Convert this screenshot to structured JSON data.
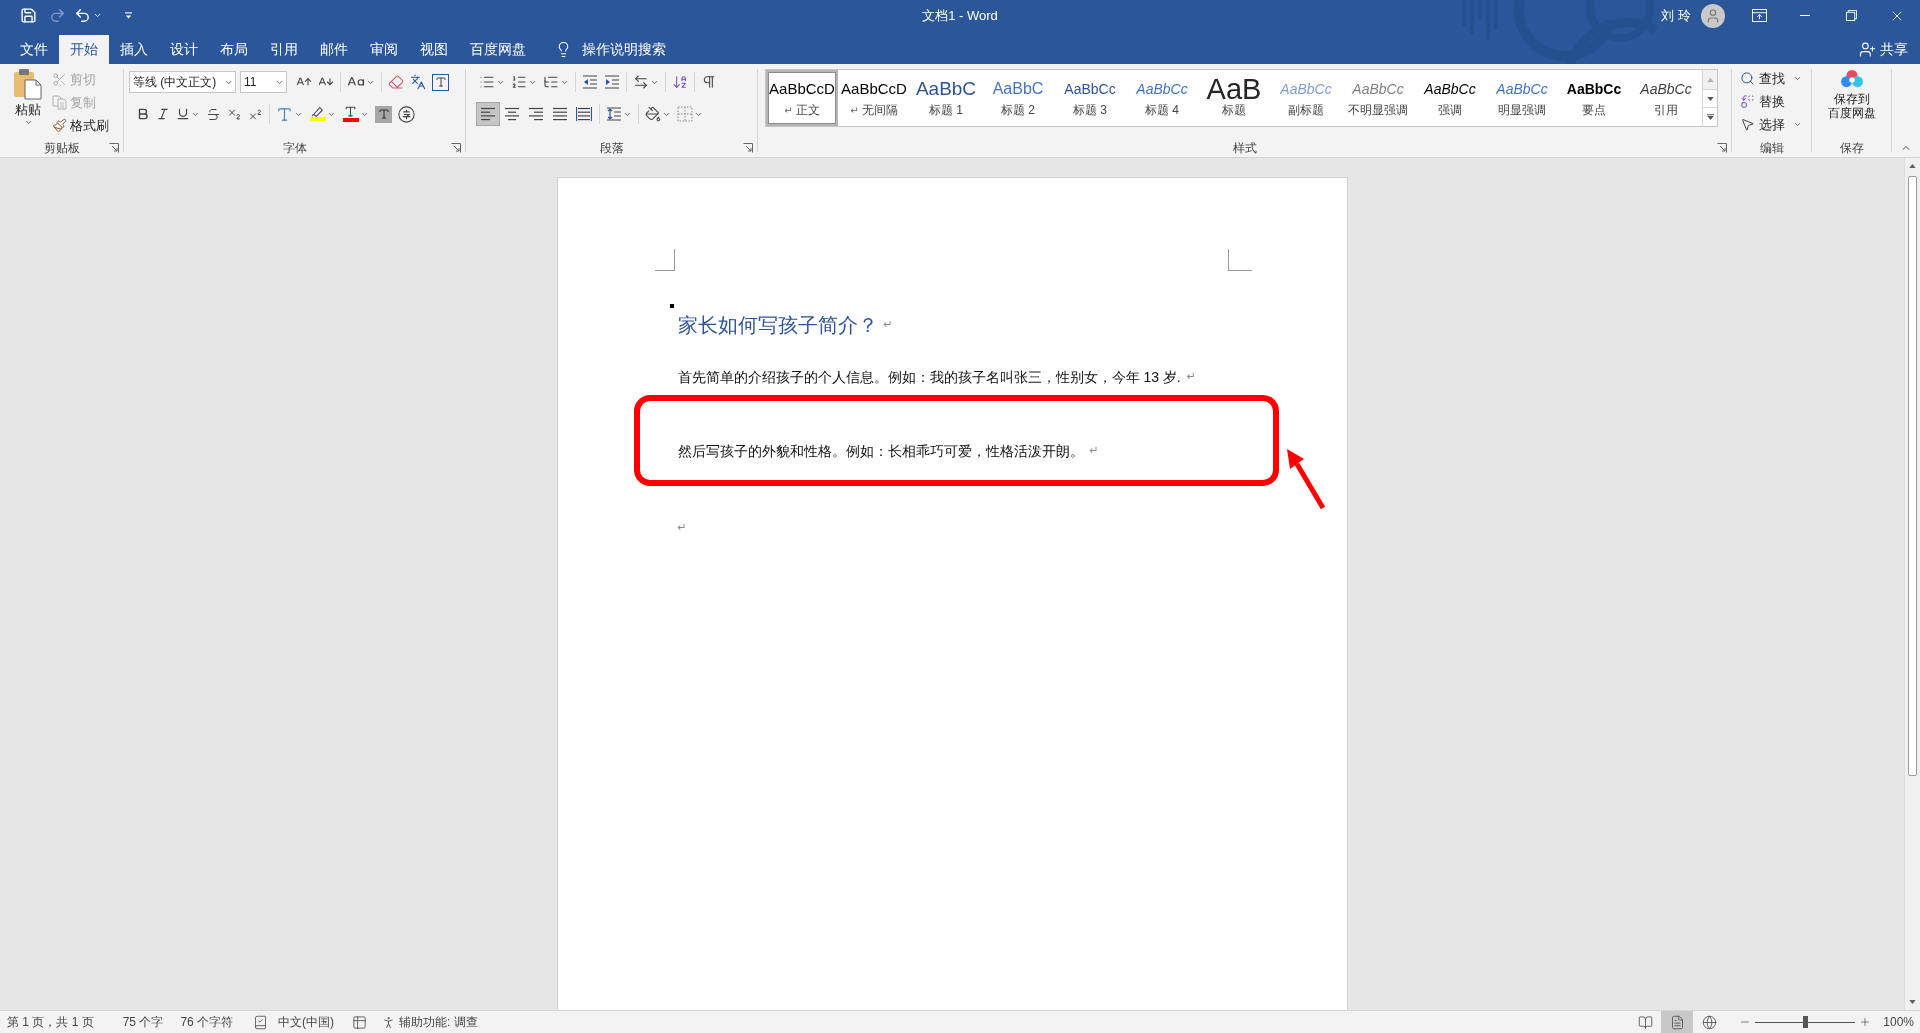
{
  "title_bar": {
    "title": "文档1 - Word",
    "user": "刘 玲"
  },
  "quick_access": [
    {
      "kind": "save",
      "disabled": false
    },
    {
      "kind": "redo",
      "disabled": true
    },
    {
      "kind": "undo",
      "disabled": false
    }
  ],
  "tabs": [
    {
      "label": "文件",
      "selected": false
    },
    {
      "label": "开始",
      "selected": true
    },
    {
      "label": "插入",
      "selected": false
    },
    {
      "label": "设计",
      "selected": false
    },
    {
      "label": "布局",
      "selected": false
    },
    {
      "label": "引用",
      "selected": false
    },
    {
      "label": "邮件",
      "selected": false
    },
    {
      "label": "审阅",
      "selected": false
    },
    {
      "label": "视图",
      "selected": false
    },
    {
      "label": "百度网盘",
      "selected": false
    }
  ],
  "tell_me": {
    "placeholder": "操作说明搜索"
  },
  "share": {
    "label": "共享"
  },
  "clipboard": {
    "title": "剪贴板",
    "paste": "粘贴",
    "items": [
      {
        "kind": "cut",
        "label": "剪切",
        "disabled": true
      },
      {
        "kind": "copy",
        "label": "复制",
        "disabled": true
      },
      {
        "kind": "painter",
        "label": "格式刷",
        "disabled": false
      }
    ]
  },
  "font": {
    "title": "字体",
    "font_name": "等线 (中文正文)",
    "font_size": "11"
  },
  "paragraph": {
    "title": "段落",
    "alignment": [
      {
        "kind": "left",
        "selected": true
      },
      {
        "kind": "center",
        "selected": false
      },
      {
        "kind": "right",
        "selected": false
      },
      {
        "kind": "justify",
        "selected": false
      },
      {
        "kind": "distributed",
        "selected": false
      }
    ]
  },
  "styles": {
    "title": "样式",
    "items": [
      {
        "sample": "AaBbCcD",
        "label": "正文",
        "mark": "↵",
        "kind": "plain",
        "color": "#000000",
        "selected": true
      },
      {
        "sample": "AaBbCcD",
        "label": "无间隔",
        "mark": "↵",
        "kind": "plain",
        "color": "#000000",
        "selected": false
      },
      {
        "sample": "AaBbC",
        "label": "标题 1",
        "kind": "heading1",
        "color": "#2f5496",
        "selected": false
      },
      {
        "sample": "AaBbC",
        "label": "标题 2",
        "kind": "heading2",
        "color": "#4472c4",
        "selected": false
      },
      {
        "sample": "AaBbCc",
        "label": "标题 3",
        "kind": "heading3",
        "color": "#2f5496",
        "selected": false
      },
      {
        "sample": "AaBbCc",
        "label": "标题 4",
        "kind": "heading4",
        "color": "#4472c4",
        "selected": false
      },
      {
        "sample": "AaB",
        "label": "标题",
        "kind": "title",
        "color": "#262626",
        "selected": false
      },
      {
        "sample": "AaBbCc",
        "label": "副标题",
        "kind": "subtitle",
        "color": "#7f9ccf",
        "selected": false
      },
      {
        "sample": "AaBbCc",
        "label": "不明显强调",
        "kind": "italic",
        "color": "#808080",
        "selected": false
      },
      {
        "sample": "AaBbCc",
        "label": "强调",
        "kind": "italic",
        "color": "#000000",
        "selected": false
      },
      {
        "sample": "AaBbCc",
        "label": "明显强调",
        "kind": "italic",
        "color": "#4472c4",
        "selected": false
      },
      {
        "sample": "AaBbCc",
        "label": "要点",
        "kind": "bold",
        "color": "#000000",
        "selected": false
      },
      {
        "sample": "AaBbCc",
        "label": "引用",
        "kind": "italic",
        "color": "#404040",
        "selected": false
      }
    ]
  },
  "editing": {
    "title": "编辑",
    "items": [
      {
        "kind": "find",
        "label": "查找",
        "dropdown": true
      },
      {
        "kind": "replace",
        "label": "替换",
        "dropdown": false
      },
      {
        "kind": "select",
        "label": "选择",
        "dropdown": true
      }
    ]
  },
  "save_group": {
    "title": "保存",
    "button_lines": [
      "保存到",
      "百度网盘"
    ]
  },
  "document": {
    "heading": {
      "text": "家长如何写孩子简介？",
      "mark": "↵"
    },
    "paragraphs": [
      {
        "text": "首先简单的介绍孩子的个人信息。例如：我的孩子名叫张三，性别女，今年 13 岁.",
        "mark": "↵"
      },
      {
        "text": "然后写孩子的外貌和性格。例如：长相乖巧可爱，性格活泼开朗。",
        "mark": "↵"
      },
      {
        "mark": "↵"
      }
    ],
    "annotation": {
      "frame": true,
      "arrow": true
    }
  },
  "status_bar": {
    "page": "第 1 页，共 1 页",
    "words": "75 个字",
    "characters": "76 个字符",
    "language": "中文(中国)",
    "accessibility": "辅助功能: 调查",
    "views": [
      {
        "kind": "read",
        "selected": false
      },
      {
        "kind": "print",
        "selected": true
      },
      {
        "kind": "web",
        "selected": false
      }
    ],
    "zoom": {
      "level": 0.5,
      "reading": "100%"
    }
  }
}
